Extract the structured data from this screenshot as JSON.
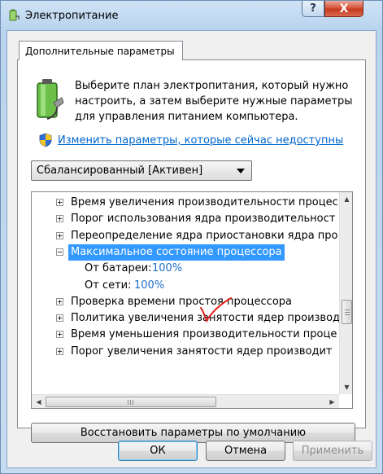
{
  "window": {
    "title": "Электропитание",
    "help_label": "?",
    "close_label": "X"
  },
  "tab": {
    "label": "Дополнительные параметры"
  },
  "description": "Выберите план электропитания, который нужно настроить, а затем выберите нужные параметры для управления питанием компьютера.",
  "change_link": "Изменить параметры, которые сейчас недоступны",
  "plan_select": {
    "value": "Сбалансированный [Активен]"
  },
  "tree": {
    "rows": [
      {
        "label": "Время увеличения производительности процес",
        "expander": "plus",
        "indent": 0,
        "selected": false
      },
      {
        "label": "Порог использования ядра производительност",
        "expander": "plus",
        "indent": 0,
        "selected": false
      },
      {
        "label": "Переопределение ядра приостановки ядра про",
        "expander": "plus",
        "indent": 0,
        "selected": false
      },
      {
        "label": "Максимальное состояние процессора",
        "expander": "minus",
        "indent": 0,
        "selected": true
      },
      {
        "label": "От батареи:",
        "value": "100%",
        "indent": 1,
        "selected": false
      },
      {
        "label": "От сети:",
        "value": "100%",
        "indent": 1,
        "selected": false
      },
      {
        "label": "Проверка времени простоя процессора",
        "expander": "plus",
        "indent": 0,
        "selected": false
      },
      {
        "label": "Политика увеличения занятости ядер производ",
        "expander": "plus",
        "indent": 0,
        "selected": false
      },
      {
        "label": "Время уменьшения производительности проце",
        "expander": "plus",
        "indent": 0,
        "selected": false
      },
      {
        "label": "Порог увеличения занятости ядер производит",
        "expander": "plus",
        "indent": 0,
        "selected": false
      }
    ]
  },
  "restore_button": "Восстановить параметры по умолчанию",
  "buttons": {
    "ok": "ОК",
    "cancel": "Отмена",
    "apply": "Применить"
  },
  "colors": {
    "selection": "#3399ff",
    "link": "#0066cc",
    "value": "#1e6fc4",
    "checkmark": "#e0201a"
  }
}
